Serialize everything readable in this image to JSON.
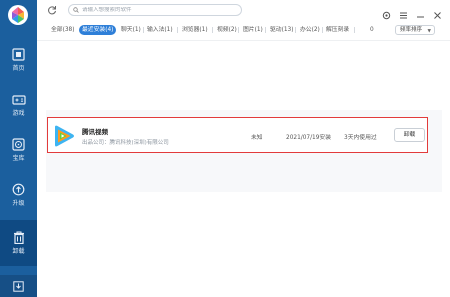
{
  "search": {
    "placeholder": "请输入想搜索的软件"
  },
  "sidebar": {
    "items": [
      {
        "label": "首页"
      },
      {
        "label": "游戏"
      },
      {
        "label": "宝库"
      },
      {
        "label": "升级"
      },
      {
        "label": "卸载"
      }
    ]
  },
  "tabs": [
    {
      "label": "全部(38)"
    },
    {
      "label": "最近安装(4)"
    },
    {
      "label": "聊天(1)"
    },
    {
      "label": "输入法(1)"
    },
    {
      "label": "浏览器(1)"
    },
    {
      "label": "视频(2)"
    },
    {
      "label": "图片(1)"
    },
    {
      "label": "驱动(13)"
    },
    {
      "label": "办公(2)"
    },
    {
      "label": "解压刻录"
    },
    {
      "label": "0"
    }
  ],
  "sort": {
    "label": "频率排序"
  },
  "apps": [
    {
      "name": "腾讯视频",
      "publisher": "出品公司：腾讯科技(深圳)有限公司",
      "size": "未知",
      "date": "2021/07/19安装",
      "usage": "3天内使用过",
      "action": "卸载"
    }
  ],
  "colors": {
    "sidebar": "#1b5f9e",
    "sidebar_active": "#0f4a83",
    "tab_active": "#2e7fd8",
    "highlight": "#e23b3b"
  }
}
